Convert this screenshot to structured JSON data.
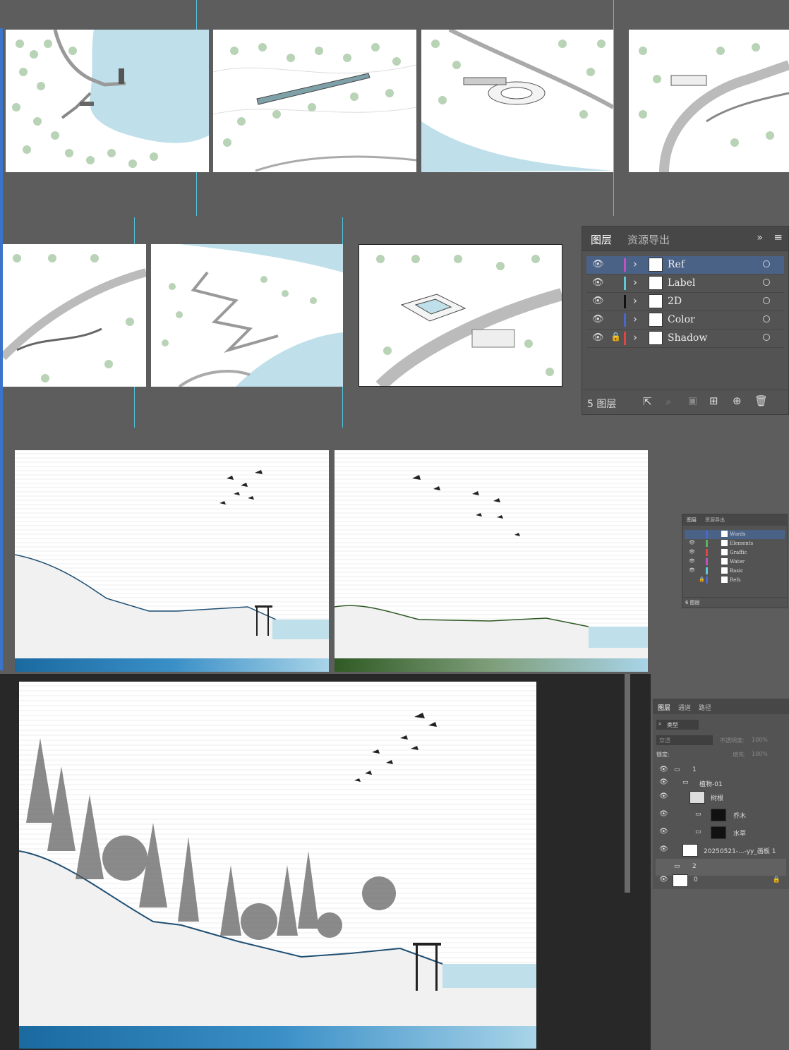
{
  "colors": {
    "workspace": "#5d5d5d",
    "guide": "#4fc3dd",
    "selection": "#4b6287",
    "water": "#bfe0ea",
    "tree": "#b9d3b6"
  },
  "ai_layers_panel": {
    "tabs": [
      "图层",
      "资源导出"
    ],
    "layers": [
      {
        "name": "Ref",
        "color": "#c151c1",
        "locked": false,
        "selected": true
      },
      {
        "name": "Label",
        "color": "#5ecad6",
        "locked": false,
        "selected": false
      },
      {
        "name": "2D",
        "color": "#111111",
        "locked": false,
        "selected": false
      },
      {
        "name": "Color",
        "color": "#4b67c9",
        "locked": false,
        "selected": false
      },
      {
        "name": "Shadow",
        "color": "#e04545",
        "locked": true,
        "selected": false
      }
    ],
    "footer_count": "5 图层"
  },
  "ai_small_panel": {
    "tabs": [
      "图层",
      "资源导出"
    ],
    "layers": [
      {
        "name": "Words",
        "color": "#4b67c9",
        "selected": true
      },
      {
        "name": "Elements",
        "color": "#5bb35b",
        "selected": false
      },
      {
        "name": "Graffic",
        "color": "#e04545",
        "selected": false
      },
      {
        "name": "Water",
        "color": "#c151c1",
        "selected": false
      },
      {
        "name": "Basic",
        "color": "#5ecad6",
        "selected": false
      },
      {
        "name": "Refs",
        "color": "#4b67c9",
        "selected": false
      }
    ],
    "footer_count": "6 图层"
  },
  "ps_layers_panel": {
    "tabs": [
      "图层",
      "通道",
      "路径"
    ],
    "filter_label": "类型",
    "blend_mode": "穿透",
    "opacity_label": "不透明度:",
    "opacity_value": "100%",
    "lock_label": "锁定:",
    "fill_label": "填充:",
    "fill_value": "100%",
    "layers": [
      {
        "name": "1",
        "type": "group",
        "indent": 0
      },
      {
        "name": "植物-01",
        "type": "group",
        "indent": 1
      },
      {
        "name": "树根",
        "type": "layer",
        "indent": 2
      },
      {
        "name": "乔木",
        "type": "masked-group",
        "indent": 2
      },
      {
        "name": "水草",
        "type": "masked-group",
        "indent": 2
      },
      {
        "name": "20250521-...-yy_画板 1",
        "type": "smart",
        "indent": 1
      },
      {
        "name": "2",
        "type": "group",
        "indent": 0,
        "hidden": true
      },
      {
        "name": "0",
        "type": "background",
        "indent": 0,
        "locked": true
      }
    ]
  }
}
